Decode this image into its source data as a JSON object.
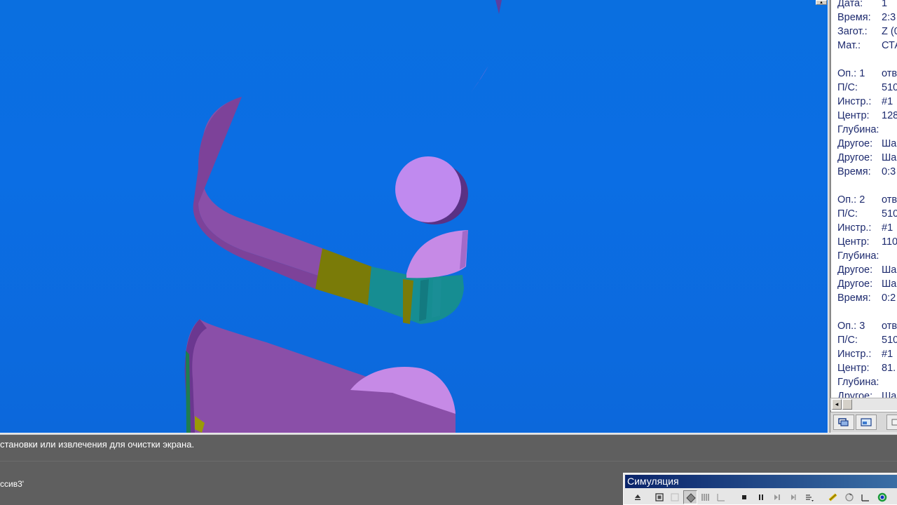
{
  "info_panel": {
    "rows": [
      {
        "label": "Дата:",
        "value": "1"
      },
      {
        "label": "Время:",
        "value": "2:3"
      },
      {
        "label": "Загот.:",
        "value": "Z (0"
      },
      {
        "label": "Мат.:",
        "value": "СТА"
      },
      {
        "label": "",
        "value": ""
      },
      {
        "label": "Оп.: 1",
        "value": "отв"
      },
      {
        "label": "П/С:",
        "value": "510"
      },
      {
        "label": "Инстр.:",
        "value": "#1"
      },
      {
        "label": "Центр:",
        "value": "128"
      },
      {
        "label": "Глубина:",
        "value": ""
      },
      {
        "label": "Другое:",
        "value": "Ша"
      },
      {
        "label": "Другое:",
        "value": "Ша"
      },
      {
        "label": "Время:",
        "value": "0:3"
      },
      {
        "label": "",
        "value": ""
      },
      {
        "label": "Оп.: 2",
        "value": "отв"
      },
      {
        "label": "П/С:",
        "value": "510"
      },
      {
        "label": "Инстр.:",
        "value": "#1"
      },
      {
        "label": "Центр:",
        "value": "110"
      },
      {
        "label": "Глубина:",
        "value": ""
      },
      {
        "label": "Другое:",
        "value": "Ша"
      },
      {
        "label": "Другое:",
        "value": "Ша"
      },
      {
        "label": "Время:",
        "value": "0:2"
      },
      {
        "label": "",
        "value": ""
      },
      {
        "label": "Оп.: 3",
        "value": "отв"
      },
      {
        "label": "П/С:",
        "value": "510"
      },
      {
        "label": "Инстр.:",
        "value": "#1"
      },
      {
        "label": "Центр:",
        "value": "81."
      },
      {
        "label": "Глубина:",
        "value": ""
      },
      {
        "label": "Другое:",
        "value": "Ша"
      }
    ],
    "tabs": [
      {
        "icon": "layers-icon"
      },
      {
        "icon": "image-icon"
      },
      {
        "icon": "script-icon"
      }
    ]
  },
  "command": {
    "prompt": "становки или извлечения для очистки экрана.",
    "input": "ссив3'"
  },
  "simulation_toolbar": {
    "title": "Симуляция",
    "buttons": [
      {
        "icon": "eject-icon"
      },
      {
        "icon": "stock-box-icon"
      },
      {
        "icon": "wireframe-icon"
      },
      {
        "icon": "solid-shade-icon"
      },
      {
        "icon": "toolpath-icon"
      },
      {
        "icon": "axes-icon"
      },
      {
        "icon": "stop-icon"
      },
      {
        "icon": "pause-icon"
      },
      {
        "icon": "step-forward-icon"
      },
      {
        "icon": "skip-end-icon"
      },
      {
        "icon": "speed-dropdown-icon"
      },
      {
        "icon": "measure-icon"
      },
      {
        "icon": "rotate-icon"
      },
      {
        "icon": "line-icon"
      },
      {
        "icon": "color-ring-icon"
      }
    ],
    "colors": {
      "title_start": "#0a246a",
      "title_end": "#3a6ea5"
    }
  },
  "viewport": {
    "colors": {
      "background": "#0b6ee4",
      "wall": "#8e4fb0",
      "wall_light": "#c090f0",
      "wall_yellow": "#7e7a08",
      "wall_teal": "#158a90",
      "hole": "#c08aef"
    }
  }
}
